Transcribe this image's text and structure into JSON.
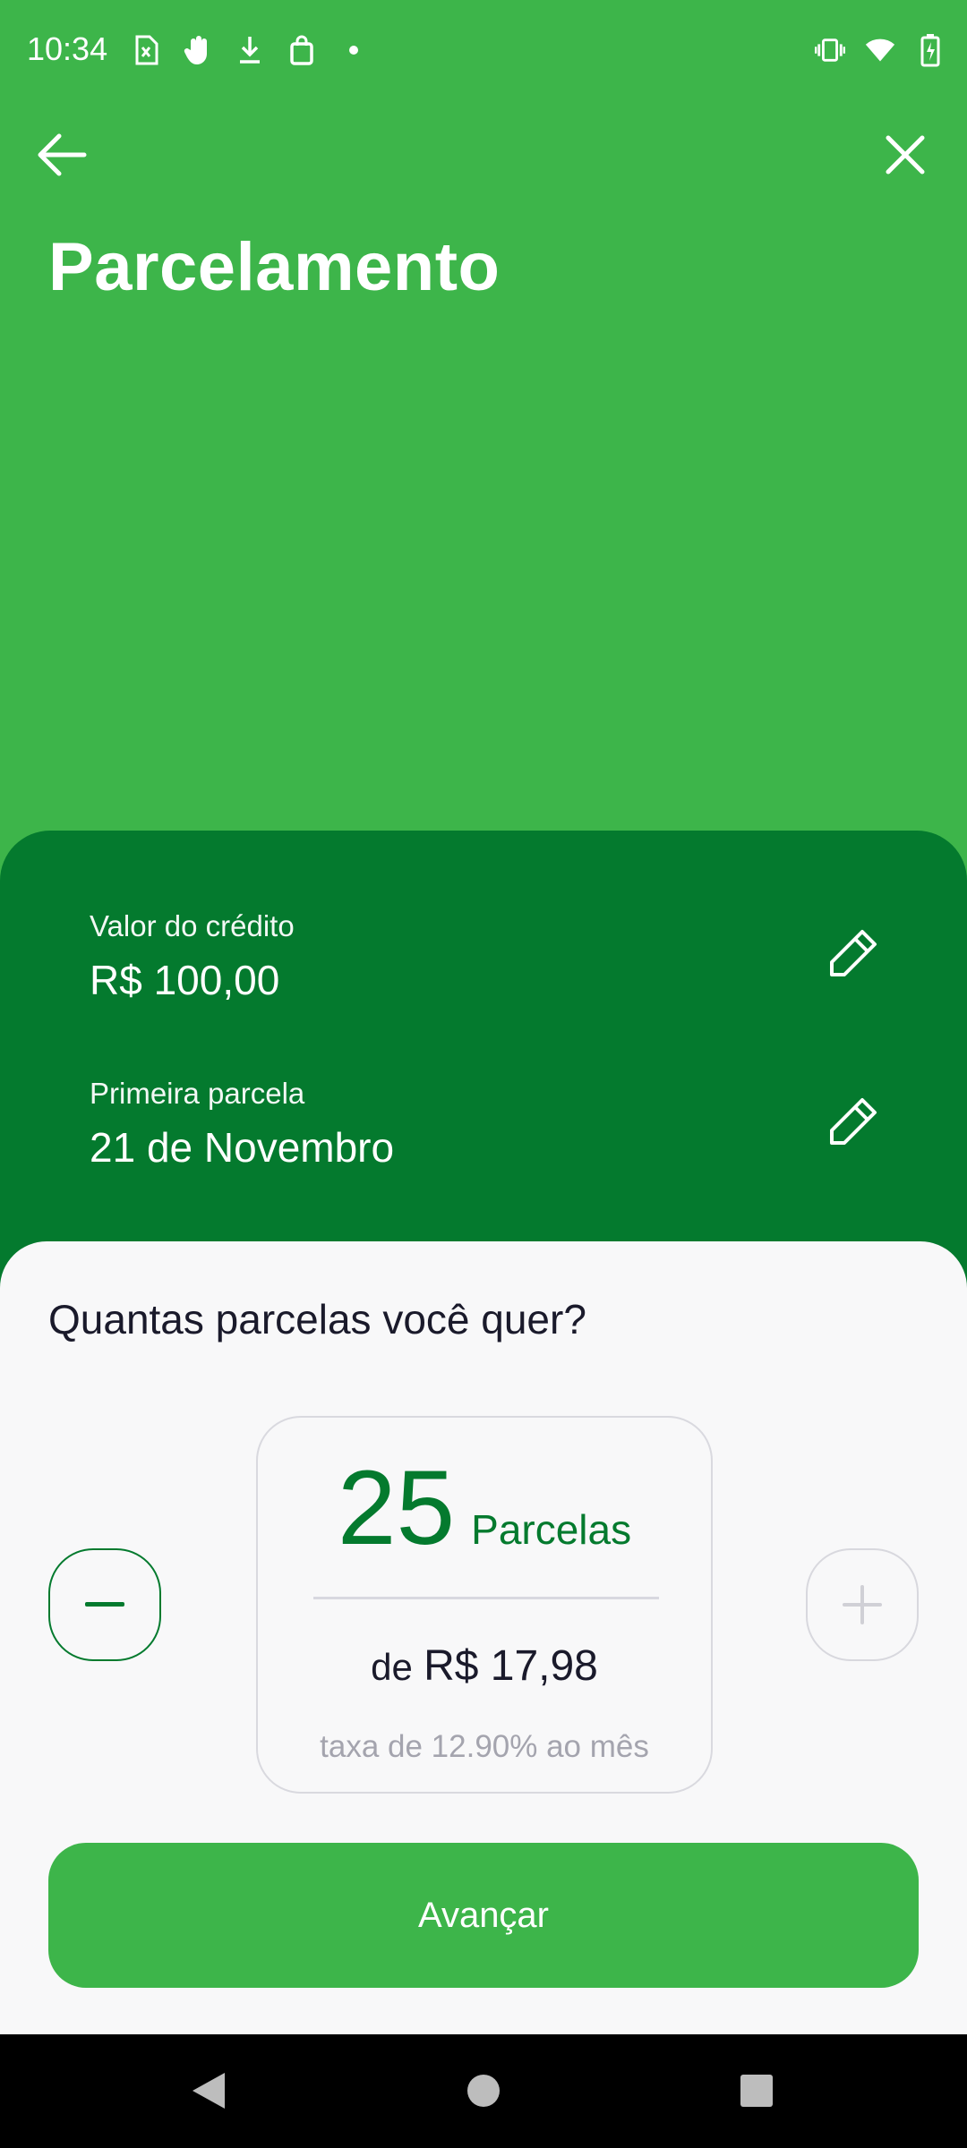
{
  "status_bar": {
    "time": "10:34",
    "left_icons": [
      "sim-alert-icon",
      "hand-gesture-icon",
      "download-icon",
      "shopping-bag-icon",
      "dot-icon"
    ],
    "right_icons": [
      "vibrate-icon",
      "wifi-icon",
      "battery-charging-icon"
    ]
  },
  "header": {
    "back_icon": "arrow-left-icon",
    "close_icon": "close-icon",
    "title": "Parcelamento"
  },
  "credit_info": {
    "amount_label": "Valor do crédito",
    "amount_value": "R$ 100,00",
    "first_installment_label": "Primeira parcela",
    "first_installment_value": "21 de Novembro",
    "edit_icon": "pencil-icon"
  },
  "installments": {
    "question": "Quantas parcelas você quer?",
    "count": "25",
    "unit": "Parcelas",
    "value_prefix": "de",
    "value_amount": "R$ 17,98",
    "rate": "taxa de 12.90% ao mês",
    "minus_icon": "minus-icon",
    "plus_icon": "plus-icon"
  },
  "actions": {
    "advance_label": "Avançar"
  },
  "colors": {
    "primary_green": "#3db54a",
    "dark_green": "#047a2e",
    "sheet_bg": "#f8f8f9",
    "text_dark": "#1a1a2b",
    "text_muted": "#a4a4ae"
  },
  "system_nav": {
    "back": "back-triangle-icon",
    "home": "home-circle-icon",
    "recents": "recents-square-icon"
  }
}
